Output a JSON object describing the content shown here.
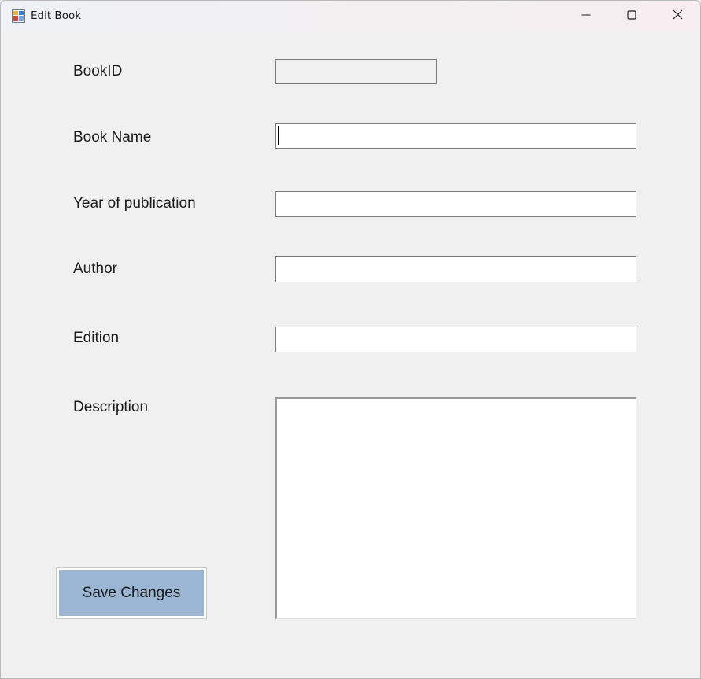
{
  "window": {
    "title": "Edit Book",
    "icon": "winforms-app-icon",
    "controls": [
      "minimize-icon",
      "maximize-icon",
      "close-icon"
    ]
  },
  "form": {
    "fields": [
      {
        "label": "BookID",
        "value": "",
        "readonly": true
      },
      {
        "label": "Book Name",
        "value": "",
        "focused": true
      },
      {
        "label": "Year of publication",
        "value": ""
      },
      {
        "label": "Author",
        "value": ""
      },
      {
        "label": "Edition",
        "value": ""
      }
    ],
    "description": {
      "label": "Description",
      "value": ""
    },
    "save_label": "Save Changes"
  },
  "colors": {
    "window_bg": "#f0f0f0",
    "button_bg": "#9bb6d3",
    "field_bg": "#ffffff",
    "field_border": "#7a7a7a"
  }
}
